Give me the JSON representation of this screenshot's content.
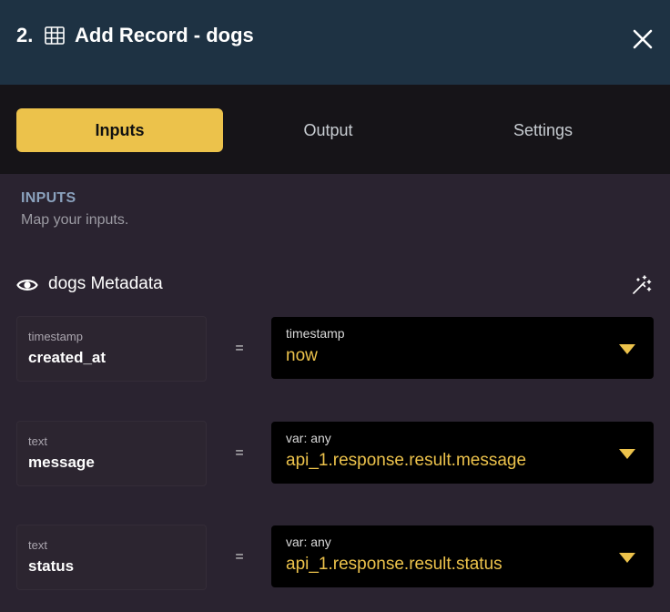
{
  "header": {
    "step": "2.",
    "title": "Add Record - dogs",
    "icons": {
      "table": "table-icon",
      "close": "close-icon"
    }
  },
  "tabs": [
    {
      "label": "Inputs",
      "active": true
    },
    {
      "label": "Output",
      "active": false
    },
    {
      "label": "Settings",
      "active": false
    }
  ],
  "section": {
    "title": "INPUTS",
    "subtitle": "Map your inputs."
  },
  "metadata": {
    "label": "dogs Metadata",
    "icons": {
      "visibility": "eye-icon",
      "auto_map": "magic-wand-icon"
    }
  },
  "mappings": [
    {
      "type": "timestamp",
      "name": "created_at",
      "operator": "=",
      "value_kind": "timestamp",
      "value": "now"
    },
    {
      "type": "text",
      "name": "message",
      "operator": "=",
      "value_kind": "var: any",
      "value": "api_1.response.result.message"
    },
    {
      "type": "text",
      "name": "status",
      "operator": "=",
      "value_kind": "var: any",
      "value": "api_1.response.result.status"
    }
  ],
  "colors": {
    "header_bg": "#1e3243",
    "tabbar_bg": "#161418",
    "body_bg": "#2a2330",
    "accent": "#ecc24b",
    "section_title": "#8ba2be"
  }
}
